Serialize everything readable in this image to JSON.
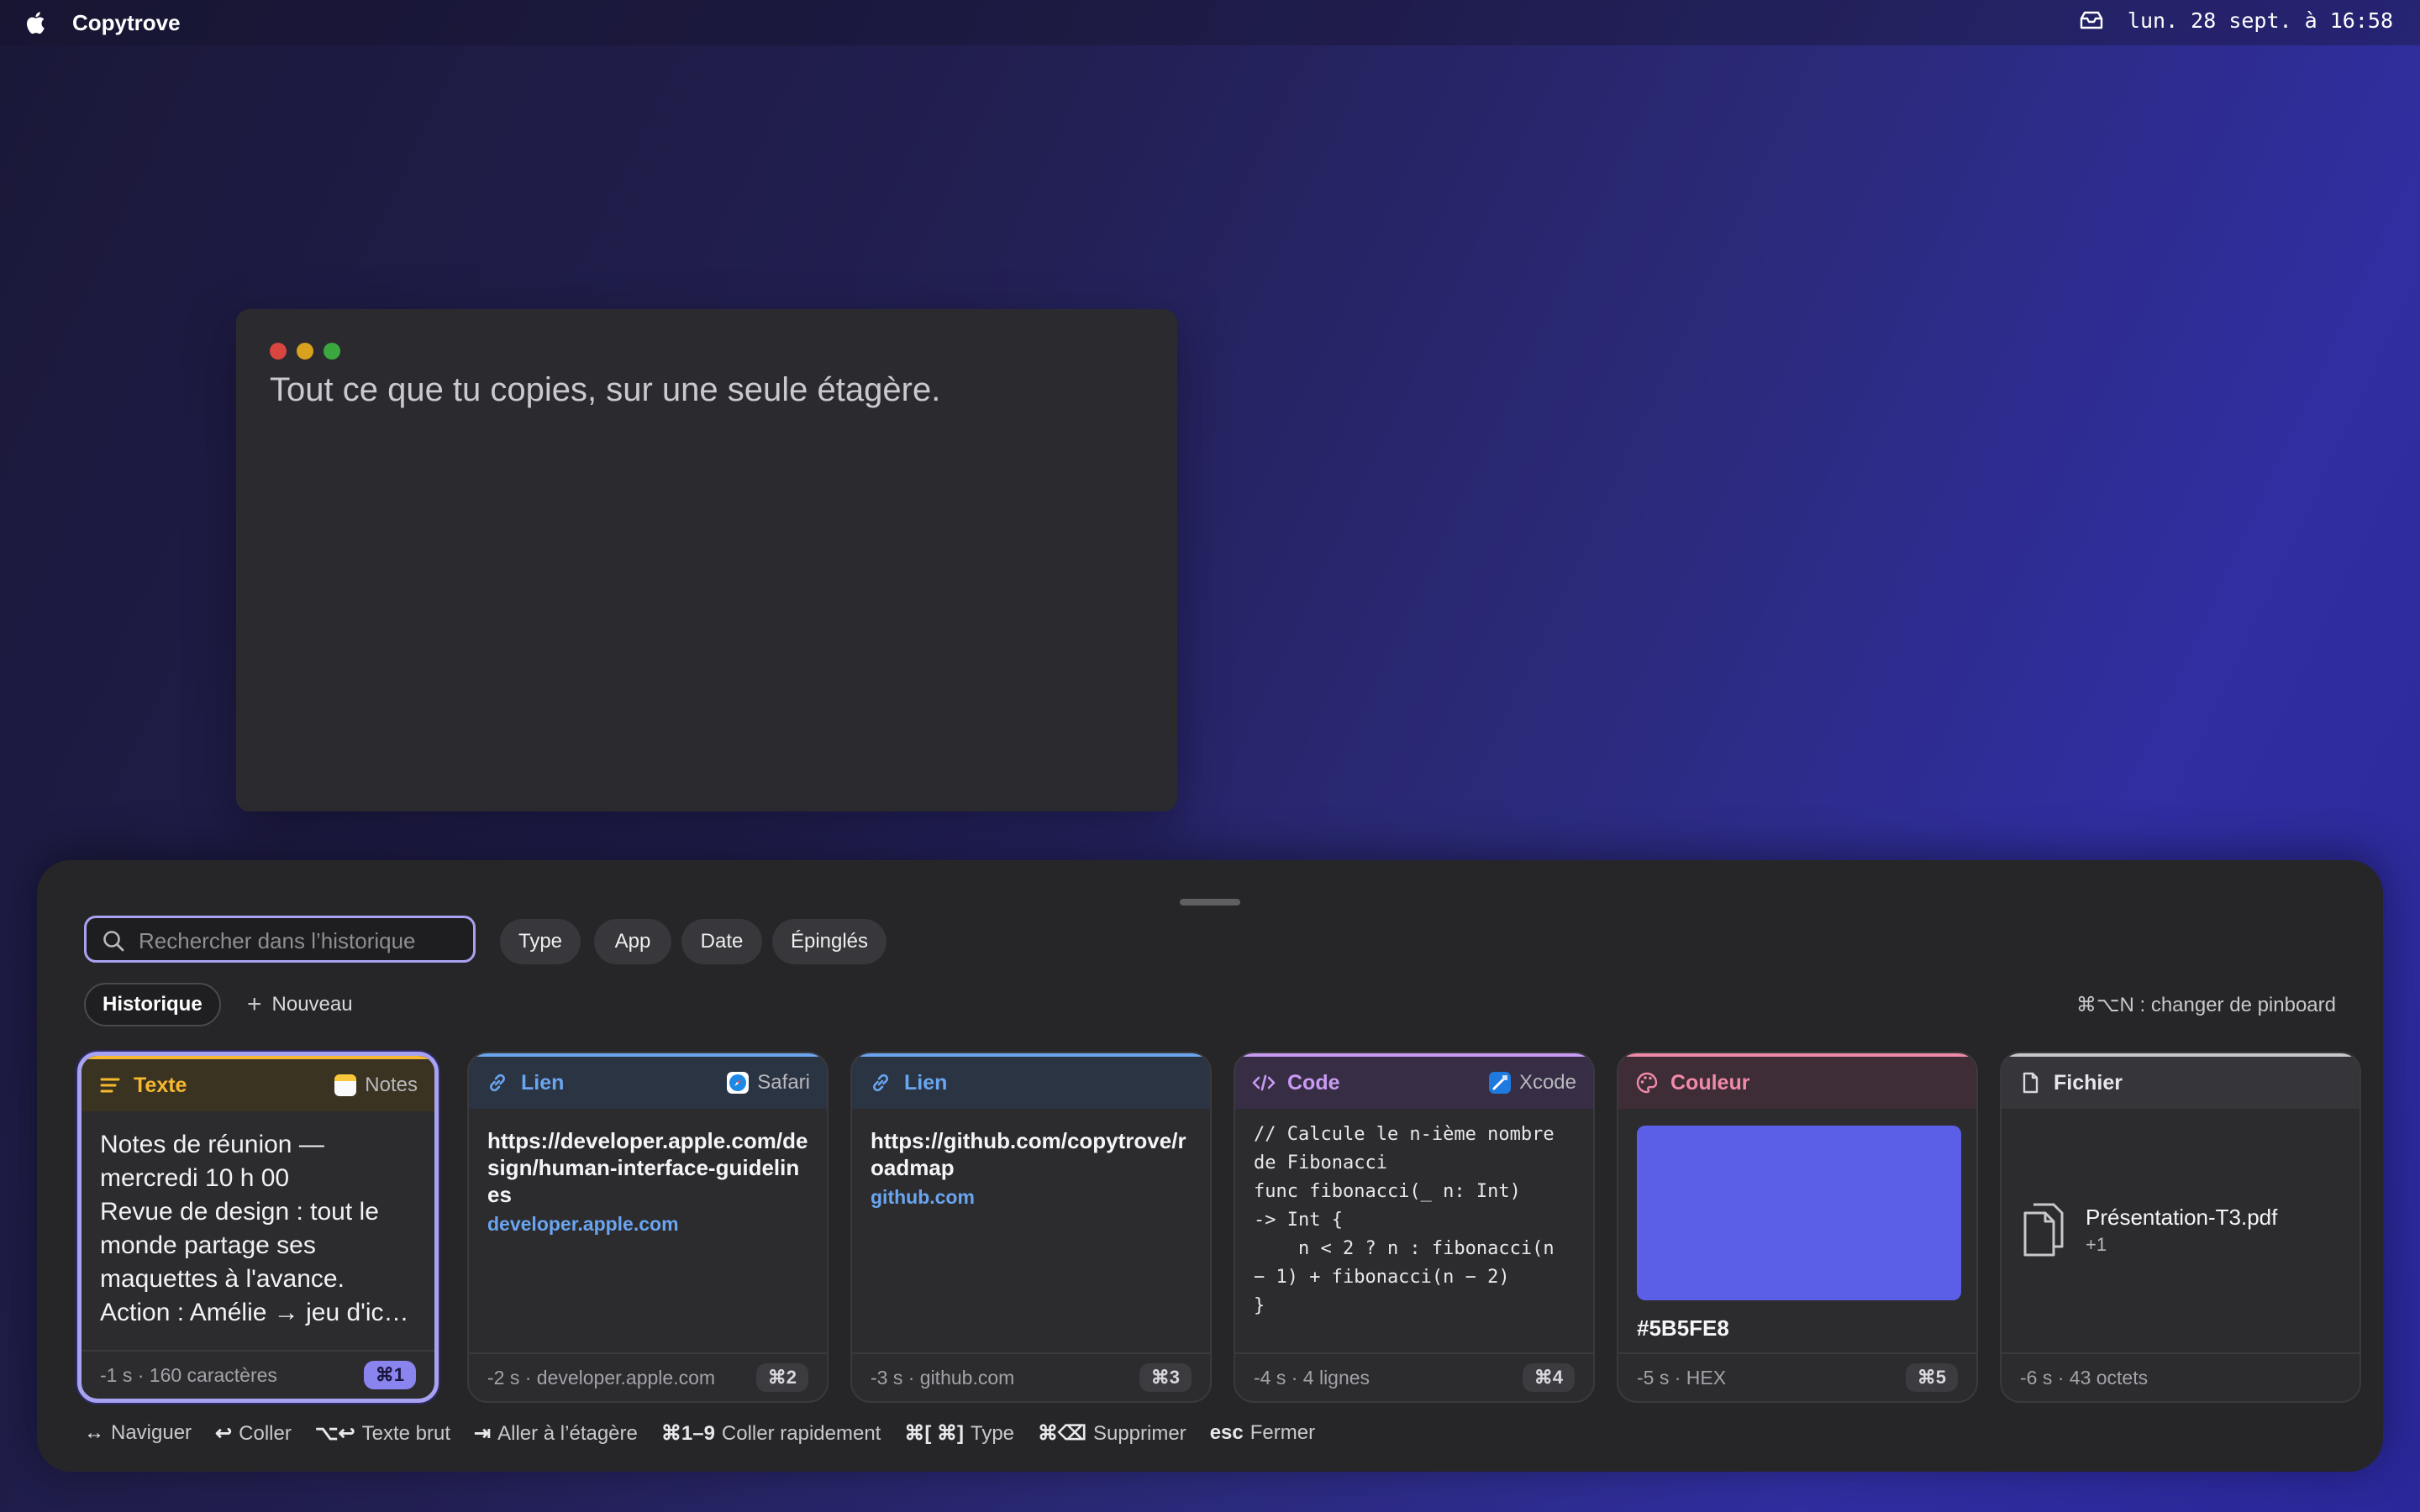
{
  "menubar": {
    "app_name": "Copytrove",
    "clock": "lun. 28 sept. à 16:58"
  },
  "document": {
    "headline": "Tout ce que tu copies, sur une seule étagère."
  },
  "shelf": {
    "search": {
      "placeholder": "Rechercher dans l’historique",
      "value": ""
    },
    "filters": [
      "Type",
      "App",
      "Date",
      "Épinglés"
    ],
    "pinboards": {
      "active": "Historique",
      "new_label": "Nouveau"
    },
    "pinboard_hint": "⌘⌥N : changer de pinboard",
    "cards": [
      {
        "type": "Texte",
        "source": "Notes",
        "lines": [
          "Notes de réunion —",
          "mercredi 10 h 00",
          "Revue de design : tout le",
          "monde partage ses",
          "maquettes à l'avance.",
          "Action : Amélie → jeu d'ic…"
        ],
        "meta": "-1 s · 160 caractères",
        "shortcut": "⌘1"
      },
      {
        "type": "Lien",
        "source": "Safari",
        "url": "https://developer.apple.com/design/human-interface-guidelines",
        "host": "developer.apple.com",
        "meta": "-2 s · developer.apple.com",
        "shortcut": "⌘2"
      },
      {
        "type": "Lien",
        "url": "https://github.com/copytrove/roadmap",
        "host": "github.com",
        "meta": "-3 s · github.com",
        "shortcut": "⌘3"
      },
      {
        "type": "Code",
        "source": "Xcode",
        "code": "// Calcule le n-ième nombre\nde Fibonacci\nfunc fibonacci(_ n: Int)\n-> Int {\n    n < 2 ? n : fibonacci(n\n− 1) + fibonacci(n − 2)\n}",
        "meta": "-4 s · 4 lignes",
        "shortcut": "⌘4"
      },
      {
        "type": "Couleur",
        "hex": "#5B5FE8",
        "meta": "-5 s · HEX",
        "shortcut": "⌘5"
      },
      {
        "type": "Fichier",
        "file_name": "Présentation-T3.pdf",
        "file_more": "+1",
        "meta": "-6 s · 43 octets"
      }
    ],
    "shortcuts": [
      {
        "key": "↔",
        "label": "Naviguer"
      },
      {
        "key": "↩",
        "label": "Coller"
      },
      {
        "key": "⌥↩",
        "label": "Texte brut"
      },
      {
        "key": "⇥",
        "label": "Aller à l’étagère"
      },
      {
        "key": "⌘1–9",
        "label": "Coller rapidement"
      },
      {
        "key": "⌘[ ⌘]",
        "label": "Type"
      },
      {
        "key": "⌘⌫",
        "label": "Supprimer"
      },
      {
        "key": "esc",
        "label": "Fermer"
      }
    ]
  },
  "colors": {
    "accent": "#A8A3F0",
    "text_type": "#F5B82E",
    "link_type": "#6AA5F0",
    "code_type": "#C99BF2",
    "color_type": "#F08AA8",
    "file_type": "#C8C8CC",
    "swatch": "#5B5FE8"
  }
}
